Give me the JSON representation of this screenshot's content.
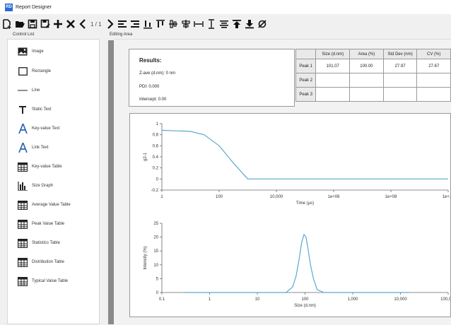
{
  "window": {
    "title": "Report Designer",
    "app_icon": "RD"
  },
  "toolbar": {
    "page_indicator": "1 / 1",
    "icons": [
      "new-page-icon",
      "open-folder-icon",
      "save-icon",
      "save-as-icon",
      "add-icon",
      "delete-icon",
      "prev-page-icon",
      "next-page-icon",
      "align-left-icon",
      "align-right-icon",
      "align-bottom-icon",
      "align-top-icon",
      "align-middle-icon",
      "align-center-icon",
      "distribute-horizontal-icon",
      "distribute-vertical-icon",
      "center-align-icon",
      "bring-to-front-icon",
      "send-to-back-icon",
      "no-link-icon"
    ]
  },
  "labels": {
    "control_list": "Control List",
    "editing_area": "Editing Area"
  },
  "controls": [
    {
      "label": "Image",
      "icon": "image-icon"
    },
    {
      "label": "Rectangle",
      "icon": "rectangle-icon"
    },
    {
      "label": "Line",
      "icon": "line-icon"
    },
    {
      "label": "Static Text",
      "icon": "static-text-icon"
    },
    {
      "label": "Key-value Text",
      "icon": "key-value-text-icon"
    },
    {
      "label": "Link Text",
      "icon": "link-text-icon"
    },
    {
      "label": "Key-value Table",
      "icon": "table-icon"
    },
    {
      "label": "Size Graph",
      "icon": "bar-graph-icon"
    },
    {
      "label": "Average Value Table",
      "icon": "table-icon"
    },
    {
      "label": "Peak Value Table",
      "icon": "table-icon"
    },
    {
      "label": "Statistics Table",
      "icon": "table-icon"
    },
    {
      "label": "Distribution Table",
      "icon": "table-icon"
    },
    {
      "label": "Typical Value Table",
      "icon": "table-icon"
    }
  ],
  "results": {
    "title": "Results:",
    "zave": "Z-ave (d.nm):  0 nm",
    "pdi": "PDI:  0.000",
    "intercept": "Intercept:  0.00"
  },
  "peak_table": {
    "headers": [
      "Size (d.nm)",
      "Area (%)",
      "Std Dev (nm)",
      "CV (%)"
    ],
    "rows": [
      {
        "name": "Peak 1",
        "values": [
          "101.07",
          "100.00",
          "27.97",
          "27.67"
        ]
      },
      {
        "name": "Peak 2",
        "values": [
          "",
          "",
          "",
          ""
        ]
      },
      {
        "name": "Peak 3",
        "values": [
          "",
          "",
          "",
          ""
        ]
      }
    ]
  },
  "chart_data": [
    {
      "type": "line",
      "xlabel": "Time (µs)",
      "ylabel": "g2-1",
      "xscale": "log",
      "xticks": [
        "1",
        "100",
        "10,000",
        "1e+06",
        "1e+08",
        "1e+10"
      ],
      "yticks": [
        "1",
        "0.8",
        "0.6",
        "0.4",
        "0.2",
        "0",
        "-0.2"
      ],
      "ylim": [
        -0.2,
        1
      ],
      "color": "#5aa8d0",
      "series": [
        {
          "x": [
            1,
            10,
            30,
            100,
            300,
            1000,
            3000,
            10000,
            10000000000.0
          ],
          "y": [
            0.88,
            0.86,
            0.8,
            0.6,
            0.3,
            0.0,
            0.0,
            0.0,
            0.0
          ]
        }
      ]
    },
    {
      "type": "line",
      "xlabel": "Size (d.nm)",
      "ylabel": "Intensity (%)",
      "xscale": "log",
      "xticks": [
        "0.1",
        "1",
        "10",
        "100",
        "1,000",
        "10,000",
        "100,000"
      ],
      "yticks": [
        "25",
        "20",
        "15",
        "10",
        "5",
        "0"
      ],
      "ylim": [
        0,
        25
      ],
      "color": "#5aa8d0",
      "series": [
        {
          "x": [
            0.3,
            40,
            55,
            65,
            75,
            85,
            95,
            105,
            115,
            130,
            150,
            180,
            250,
            15000
          ],
          "y": [
            0,
            0,
            2,
            6,
            12,
            18,
            21,
            20,
            16,
            10,
            5,
            1,
            0,
            0
          ]
        }
      ]
    }
  ]
}
